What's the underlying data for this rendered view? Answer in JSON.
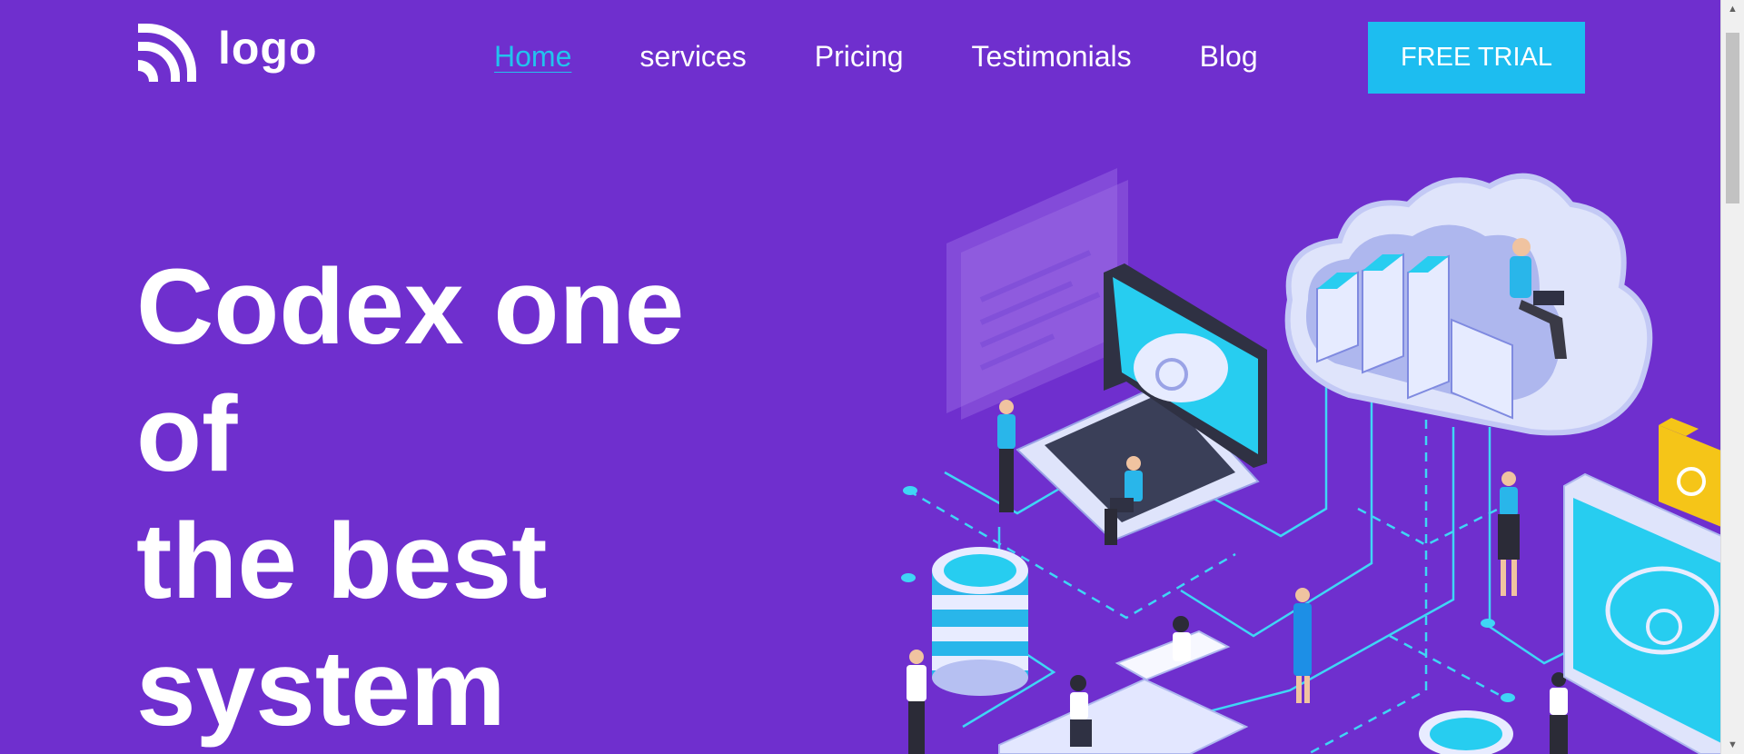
{
  "brand": {
    "logo_text": "logo"
  },
  "nav": {
    "items": [
      {
        "label": "Home",
        "active": true
      },
      {
        "label": "services",
        "active": false
      },
      {
        "label": "Pricing",
        "active": false
      },
      {
        "label": "Testimonials",
        "active": false
      },
      {
        "label": "Blog",
        "active": false
      }
    ],
    "cta_label": "FREE TRIAL"
  },
  "hero": {
    "title_lines": [
      "Codex one",
      "of",
      "the best",
      "system"
    ]
  },
  "colors": {
    "background": "#6f2fce",
    "accent": "#1dbdf0",
    "active_link": "#22c3ee",
    "text": "#ffffff"
  },
  "icons": {
    "logo": "rss-arcs-icon",
    "scroll_up": "triangle-up-icon",
    "scroll_down": "triangle-down-icon"
  }
}
